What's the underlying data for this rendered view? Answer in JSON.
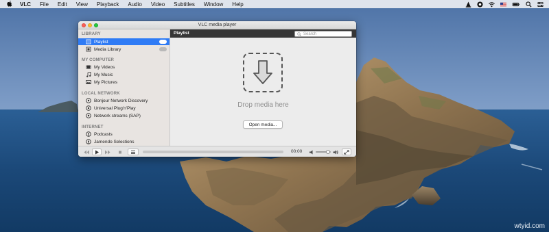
{
  "menubar": {
    "app_name": "VLC",
    "items": [
      "File",
      "Edit",
      "View",
      "Playback",
      "Audio",
      "Video",
      "Subtitles",
      "Window",
      "Help"
    ],
    "status_icons": [
      "vlc-cone-icon",
      "record-icon",
      "wifi-icon",
      "us-flag-icon",
      "battery-icon",
      "search-icon",
      "control-center-icon"
    ]
  },
  "window": {
    "title": "VLC media player",
    "sidebar": {
      "sections": [
        {
          "header": "LIBRARY",
          "items": [
            {
              "label": "Playlist",
              "icon": "playlist-icon",
              "selected": true,
              "badge": true
            },
            {
              "label": "Media Library",
              "icon": "media-library-icon",
              "selected": false,
              "badge": true
            }
          ]
        },
        {
          "header": "MY COMPUTER",
          "items": [
            {
              "label": "My Videos",
              "icon": "video-icon"
            },
            {
              "label": "My Music",
              "icon": "music-icon"
            },
            {
              "label": "My Pictures",
              "icon": "pictures-icon"
            }
          ]
        },
        {
          "header": "LOCAL NETWORK",
          "items": [
            {
              "label": "Bonjour Network Discovery",
              "icon": "network-icon"
            },
            {
              "label": "Universal Plug'n'Play",
              "icon": "network-icon"
            },
            {
              "label": "Network streams (SAP)",
              "icon": "network-icon"
            }
          ]
        },
        {
          "header": "INTERNET",
          "items": [
            {
              "label": "Podcasts",
              "icon": "podcast-icon"
            },
            {
              "label": "Jamendo Selections",
              "icon": "podcast-icon"
            }
          ]
        }
      ]
    },
    "main": {
      "header_label": "Playlist",
      "search_placeholder": "Search",
      "drop_text": "Drop media here",
      "open_button": "Open media..."
    },
    "controls": {
      "time": "00:00",
      "progress": 0,
      "volume": 0.8
    }
  },
  "watermark": "wtyid.com",
  "colors": {
    "selection": "#2f7bf5",
    "header_bar": "#363636",
    "close": "#fc5f57",
    "minimize": "#fdbc2e",
    "maximize": "#28c840"
  }
}
